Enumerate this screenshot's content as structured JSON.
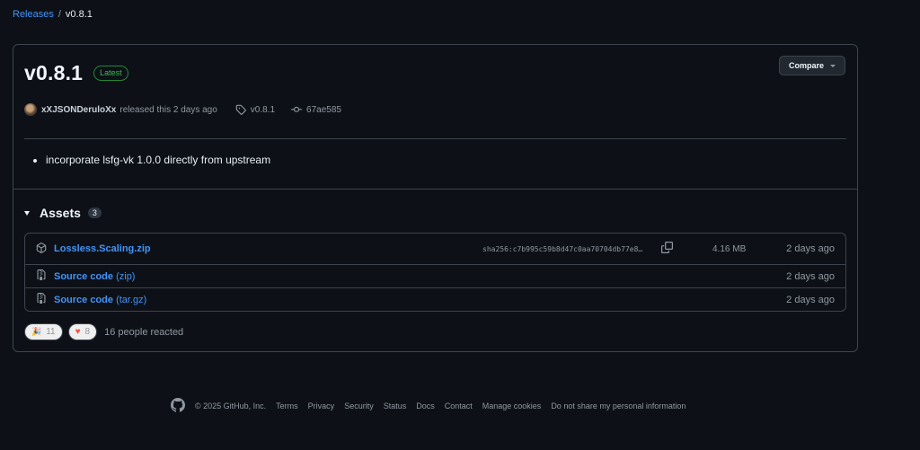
{
  "breadcrumb": {
    "root": "Releases",
    "separator": "/",
    "current": "v0.8.1"
  },
  "release": {
    "title": "v0.8.1",
    "badge": "Latest",
    "compare_label": "Compare",
    "author": "xXJSONDeruloXx",
    "released_text": "released this 2 days ago",
    "tag": "v0.8.1",
    "commit": "67ae585",
    "notes": [
      "incorporate lsfg-vk 1.0.0 directly from upstream"
    ]
  },
  "assets": {
    "title": "Assets",
    "count": "3",
    "rows": [
      {
        "icon": "package-icon",
        "name": "Lossless.Scaling.zip",
        "suffix": "",
        "hash": "sha256:c7b995c59b8d47c0aa70704db77e8…",
        "size": "4.16 MB",
        "date": "2 days ago"
      },
      {
        "icon": "file-zip-icon",
        "name": "Source code",
        "suffix": " (zip)",
        "hash": "",
        "size": "",
        "date": "2 days ago"
      },
      {
        "icon": "file-zip-icon",
        "name": "Source code",
        "suffix": " (tar.gz)",
        "hash": "",
        "size": "",
        "date": "2 days ago"
      }
    ]
  },
  "reactions": {
    "items": [
      {
        "icon": "tada-icon",
        "count": "11"
      },
      {
        "icon": "heart-icon",
        "count": "8"
      }
    ],
    "summary": "16 people reacted"
  },
  "footer": {
    "copyright": "© 2025 GitHub, Inc.",
    "links": [
      "Terms",
      "Privacy",
      "Security",
      "Status",
      "Docs",
      "Contact",
      "Manage cookies",
      "Do not share my personal information"
    ]
  },
  "colors": {
    "background": "#0d1117",
    "link": "#4493f8",
    "border": "#3d444d",
    "latest": "#3fb950"
  }
}
